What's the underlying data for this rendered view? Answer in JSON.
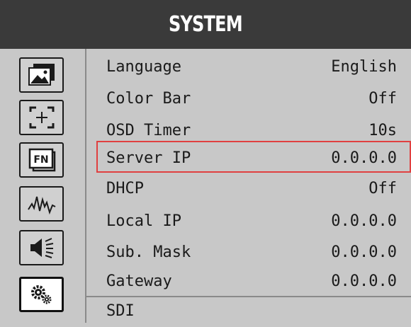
{
  "title": "SYSTEM",
  "sidebar": {
    "items": [
      {
        "icon": "picture-icon"
      },
      {
        "icon": "marker-icon"
      },
      {
        "icon": "fn-icon"
      },
      {
        "icon": "waveform-icon"
      },
      {
        "icon": "speaker-icon"
      },
      {
        "icon": "gears-icon",
        "active": true
      }
    ]
  },
  "menu": {
    "items": [
      {
        "label": "Language",
        "value": "English"
      },
      {
        "label": "Color Bar",
        "value": "Off"
      },
      {
        "label": "OSD Timer",
        "value": "10s"
      },
      {
        "label": "Server IP",
        "value": "0.0.0.0",
        "selected": true
      },
      {
        "label": "DHCP",
        "value": "Off"
      },
      {
        "label": "Local IP",
        "value": "0.0.0.0"
      },
      {
        "label": "Sub. Mask",
        "value": "0.0.0.0"
      },
      {
        "label": "Gateway",
        "value": "0.0.0.0"
      },
      {
        "label": "SDI",
        "value": ""
      }
    ]
  },
  "colors": {
    "title_bg": "#3a3a3a",
    "panel_bg": "#c8c8c8",
    "selection_border": "#e04040"
  }
}
